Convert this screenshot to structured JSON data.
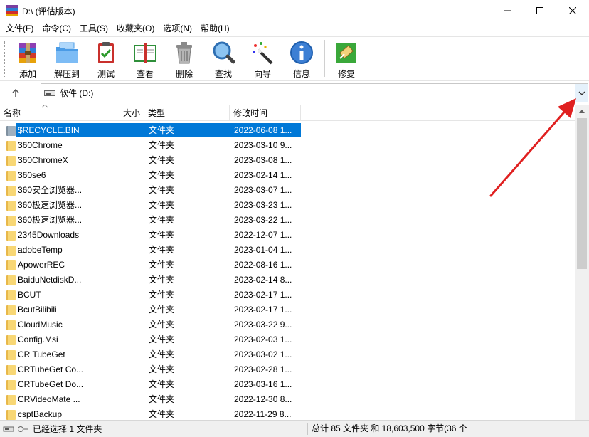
{
  "window": {
    "title": "D:\\ (评估版本)"
  },
  "menu": [
    "文件(F)",
    "命令(C)",
    "工具(S)",
    "收藏夹(O)",
    "选项(N)",
    "帮助(H)"
  ],
  "toolbar": [
    {
      "label": "添加",
      "icon": "archive-add-icon"
    },
    {
      "label": "解压到",
      "icon": "extract-folder-icon"
    },
    {
      "label": "测试",
      "icon": "test-clipboard-icon"
    },
    {
      "label": "查看",
      "icon": "view-book-icon"
    },
    {
      "label": "删除",
      "icon": "trash-icon"
    },
    {
      "label": "查找",
      "icon": "magnifier-icon"
    },
    {
      "label": "向导",
      "icon": "wizard-wand-icon"
    },
    {
      "label": "信息",
      "icon": "info-icon"
    },
    {
      "label": "修复",
      "icon": "repair-icon"
    }
  ],
  "address": {
    "path": "软件 (D:)"
  },
  "columns": {
    "name": "名称",
    "size": "大小",
    "type": "类型",
    "modified": "修改时间"
  },
  "files": [
    {
      "name": "$RECYCLE.BIN",
      "type": "文件夹",
      "modified": "2022-06-08 1...",
      "selected": true
    },
    {
      "name": "360Chrome",
      "type": "文件夹",
      "modified": "2023-03-10 9..."
    },
    {
      "name": "360ChromeX",
      "type": "文件夹",
      "modified": "2023-03-08 1..."
    },
    {
      "name": "360se6",
      "type": "文件夹",
      "modified": "2023-02-14 1..."
    },
    {
      "name": "360安全浏览器...",
      "type": "文件夹",
      "modified": "2023-03-07 1..."
    },
    {
      "name": "360极速浏览器...",
      "type": "文件夹",
      "modified": "2023-03-23 1..."
    },
    {
      "name": "360极速浏览器...",
      "type": "文件夹",
      "modified": "2023-03-22 1..."
    },
    {
      "name": "2345Downloads",
      "type": "文件夹",
      "modified": "2022-12-07 1..."
    },
    {
      "name": "adobeTemp",
      "type": "文件夹",
      "modified": "2023-01-04 1..."
    },
    {
      "name": "ApowerREC",
      "type": "文件夹",
      "modified": "2022-08-16 1..."
    },
    {
      "name": "BaiduNetdiskD...",
      "type": "文件夹",
      "modified": "2023-02-14 8..."
    },
    {
      "name": "BCUT",
      "type": "文件夹",
      "modified": "2023-02-17 1..."
    },
    {
      "name": "BcutBilibili",
      "type": "文件夹",
      "modified": "2023-02-17 1..."
    },
    {
      "name": "CloudMusic",
      "type": "文件夹",
      "modified": "2023-03-22 9..."
    },
    {
      "name": "Config.Msi",
      "type": "文件夹",
      "modified": "2023-02-03 1..."
    },
    {
      "name": "CR TubeGet",
      "type": "文件夹",
      "modified": "2023-03-02 1..."
    },
    {
      "name": "CRTubeGet Co...",
      "type": "文件夹",
      "modified": "2023-02-28 1..."
    },
    {
      "name": "CRTubeGet Do...",
      "type": "文件夹",
      "modified": "2023-03-16 1..."
    },
    {
      "name": "CRVideoMate ...",
      "type": "文件夹",
      "modified": "2022-12-30 8..."
    },
    {
      "name": "csptBackup",
      "type": "文件夹",
      "modified": "2022-11-29 8..."
    }
  ],
  "status": {
    "left": "已经选择 1 文件夹",
    "right": "总计 85 文件夹 和 18,603,500 字节(36 个"
  },
  "colors": {
    "selection": "#0078d7",
    "annotation_arrow": "#e02020",
    "folder": "#f8d775"
  }
}
